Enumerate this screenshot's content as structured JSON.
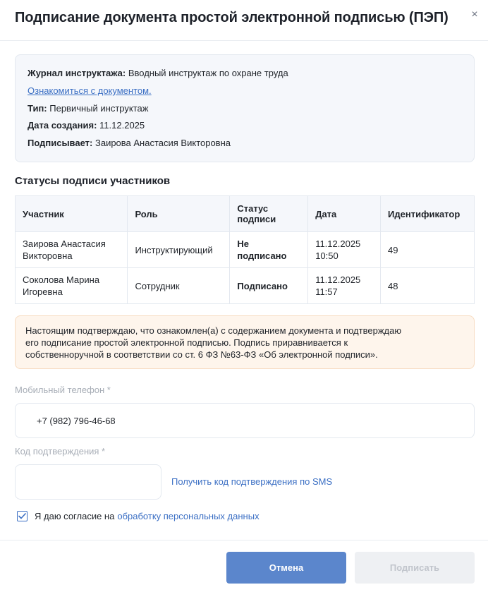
{
  "modal": {
    "title": "Подписание документа простой электронной подписью (ПЭП)",
    "close_icon": "×"
  },
  "info": {
    "journal_label": "Журнал инструктажа:",
    "journal_value": "Вводный инструктаж по охране труда",
    "doc_link": "Ознакомиться с документом.",
    "type_label": "Тип:",
    "type_value": "Первичный инструктаж",
    "created_label": "Дата создания:",
    "created_value": "11.12.2025",
    "signer_label": "Подписывает:",
    "signer_value": "Заирова Анастасия Викторовна"
  },
  "statuses": {
    "title": "Статусы подписи участников",
    "headers": {
      "participant": "Участник",
      "role": "Роль",
      "status_line1": "Статус",
      "status_line2": "подписи",
      "date": "Дата",
      "id": "Идентификатор"
    },
    "rows": [
      {
        "name_line1": "Заирова Анастасия",
        "name_line2": "Викторовна",
        "role": "Инструктирующий",
        "status_line1": "Не",
        "status_line2": "подписано",
        "status_color": "#c2282c",
        "date_line1": "11.12.2025",
        "date_line2": "10:50",
        "id": "49"
      },
      {
        "name_line1": "Соколова Марина",
        "name_line2": "Игоревна",
        "role": "Сотрудник",
        "status": "Подписано",
        "status_color": "#2d8a3a",
        "date_line1": "11.12.2025",
        "date_line2": "11:57",
        "id": "48"
      }
    ]
  },
  "notice": {
    "line1": "Настоящим подтверждаю, что ознакомлен(а) с содержанием документа и подтверждаю",
    "line2": "его подписание простой электронной подписью. Подпись приравнивается к",
    "line3": "собственноручной в соответствии со ст. 6 ФЗ №63-ФЗ «Об электронной подписи»."
  },
  "form": {
    "phone_label": "Мобильный телефон *",
    "phone_value": "+7 (982) 796-46-68",
    "code_label": "Код подтверждения *",
    "code_value": "",
    "sms_link": "Получить код подтверждения по SMS",
    "consent_text": "Я даю согласие на",
    "consent_link": "обработку персональных данных",
    "consent_checked": true
  },
  "buttons": {
    "cancel": "Отмена",
    "sign": "Подписать"
  },
  "colors": {
    "accent": "#3b6fc4",
    "cancel_bg": "#5b86cc",
    "disabled_bg": "#eef0f3",
    "notice_bg": "#fef5ec",
    "unsigned": "#c2282c",
    "signed": "#2d8a3a"
  }
}
